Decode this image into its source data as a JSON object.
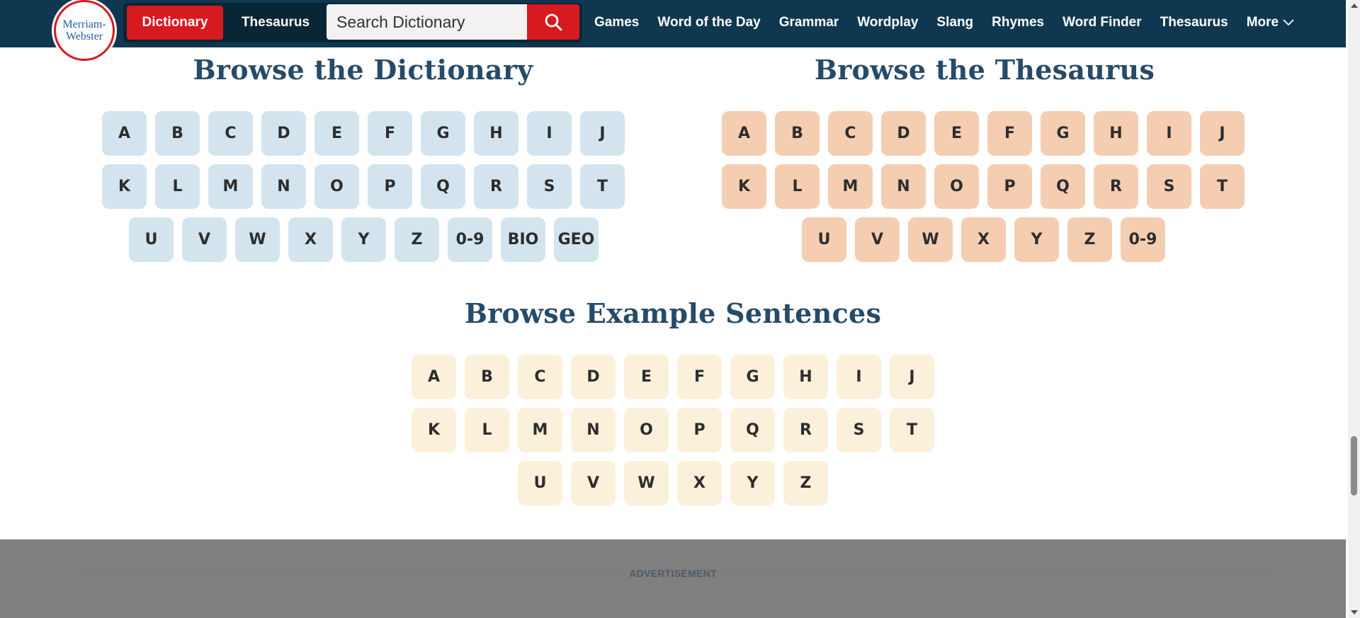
{
  "header": {
    "logo_line1": "Merriam-",
    "logo_line2": "Webster",
    "tab_dictionary": "Dictionary",
    "tab_thesaurus": "Thesaurus",
    "search_placeholder": "Search Dictionary",
    "nav": [
      "Games",
      "Word of the Day",
      "Grammar",
      "Wordplay",
      "Slang",
      "Rhymes",
      "Word Finder",
      "Thesaurus"
    ],
    "more_label": "More",
    "accent_color": "#d71920",
    "bg_color": "#0f3850"
  },
  "dictionary": {
    "title": "Browse the Dictionary",
    "rows": [
      [
        "A",
        "B",
        "C",
        "D",
        "E",
        "F",
        "G",
        "H",
        "I",
        "J"
      ],
      [
        "K",
        "L",
        "M",
        "N",
        "O",
        "P",
        "Q",
        "R",
        "S",
        "T"
      ],
      [
        "U",
        "V",
        "W",
        "X",
        "Y",
        "Z",
        "0-9",
        "BIO",
        "GEO"
      ]
    ],
    "color": "#d3e4ee"
  },
  "thesaurus": {
    "title": "Browse the Thesaurus",
    "rows": [
      [
        "A",
        "B",
        "C",
        "D",
        "E",
        "F",
        "G",
        "H",
        "I",
        "J"
      ],
      [
        "K",
        "L",
        "M",
        "N",
        "O",
        "P",
        "Q",
        "R",
        "S",
        "T"
      ],
      [
        "U",
        "V",
        "W",
        "X",
        "Y",
        "Z",
        "0-9"
      ]
    ],
    "color": "#f5cdb1"
  },
  "sentences": {
    "title": "Browse Example Sentences",
    "rows": [
      [
        "A",
        "B",
        "C",
        "D",
        "E",
        "F",
        "G",
        "H",
        "I",
        "J"
      ],
      [
        "K",
        "L",
        "M",
        "N",
        "O",
        "P",
        "Q",
        "R",
        "S",
        "T"
      ],
      [
        "U",
        "V",
        "W",
        "X",
        "Y",
        "Z"
      ]
    ],
    "color": "#fbf0d9"
  },
  "advertisement": {
    "label": "ADVERTISEMENT"
  }
}
